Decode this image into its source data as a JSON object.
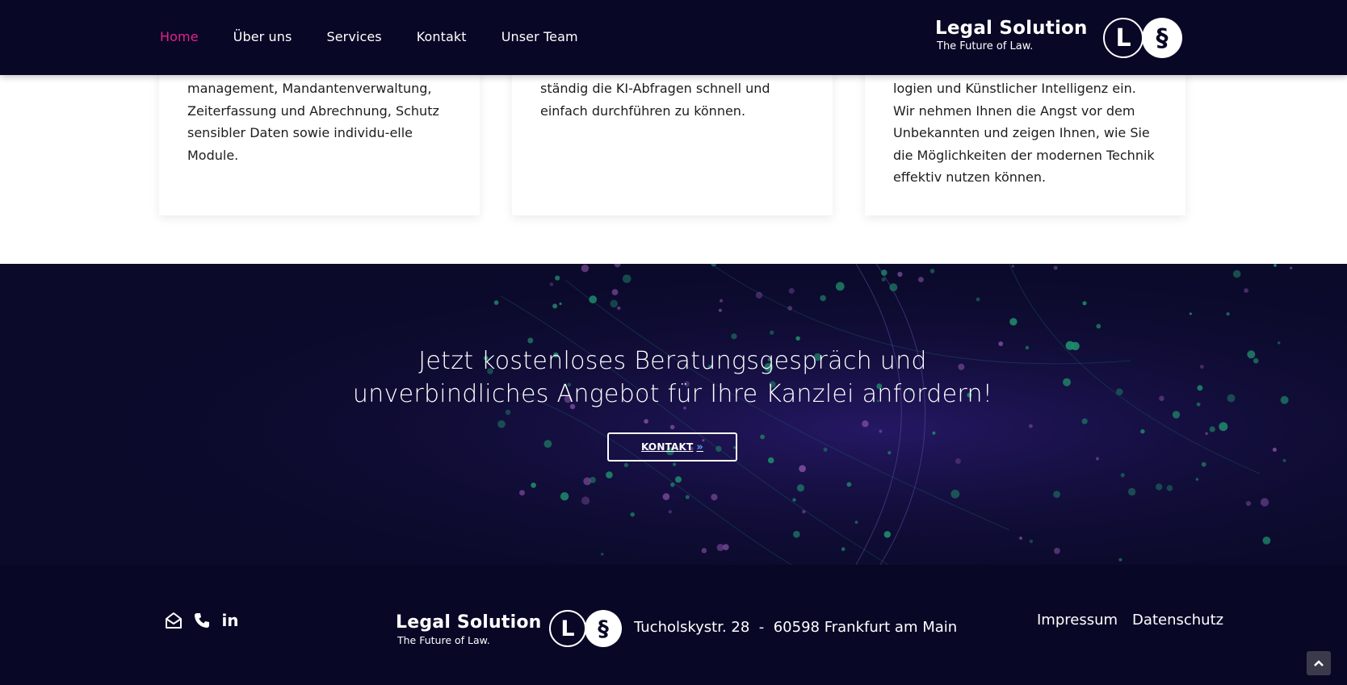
{
  "header": {
    "nav": [
      {
        "label": "Home",
        "active": true
      },
      {
        "label": "Über uns"
      },
      {
        "label": "Services"
      },
      {
        "label": "Kontakt"
      },
      {
        "label": "Unser Team"
      }
    ],
    "brand_title": "Legal Solution",
    "brand_subtitle": "The Future of Law.",
    "logo_letters": [
      "L",
      "§"
    ]
  },
  "cards": [
    {
      "text": "management, Mandantenverwaltung, Zeiterfassung und Abrechnung, Schutz sensibler Daten sowie individu-elle Module."
    },
    {
      "text": "ständig die KI-Abfragen schnell und einfach durchführen zu können."
    },
    {
      "text": "logien und Künstlicher Intelligenz ein. Wir nehmen Ihnen die Angst vor dem Unbekannten und zeigen Ihnen, wie Sie die Möglichkeiten der modernen Technik effektiv nutzen können."
    }
  ],
  "cta": {
    "title_line1": "Jetzt kostenloses Beratungsgespräch und",
    "title_line2": "unverbindliches Angebot für Ihre Kanzlei anfordern!",
    "button_label": "KONTAKT",
    "button_arrow": "»"
  },
  "footer": {
    "social_icons": [
      "envelope-open-icon",
      "phone-icon",
      "linkedin-icon"
    ],
    "linkedin_text": "in",
    "brand_title": "Legal Solution",
    "brand_subtitle": "The Future of Law.",
    "logo_letters": [
      "L",
      "§"
    ],
    "address": "Tucholskystr. 28  -  60598 Frankfurt am Main",
    "links": [
      "Impressum",
      "Datenschutz"
    ],
    "back_to_top_icon": "chevron-up-icon"
  },
  "colors": {
    "nav_bg": "#080726",
    "accent": "#e0238c",
    "cta_bg": "#0b0a2b",
    "button_arrow": "#5a9cff"
  }
}
